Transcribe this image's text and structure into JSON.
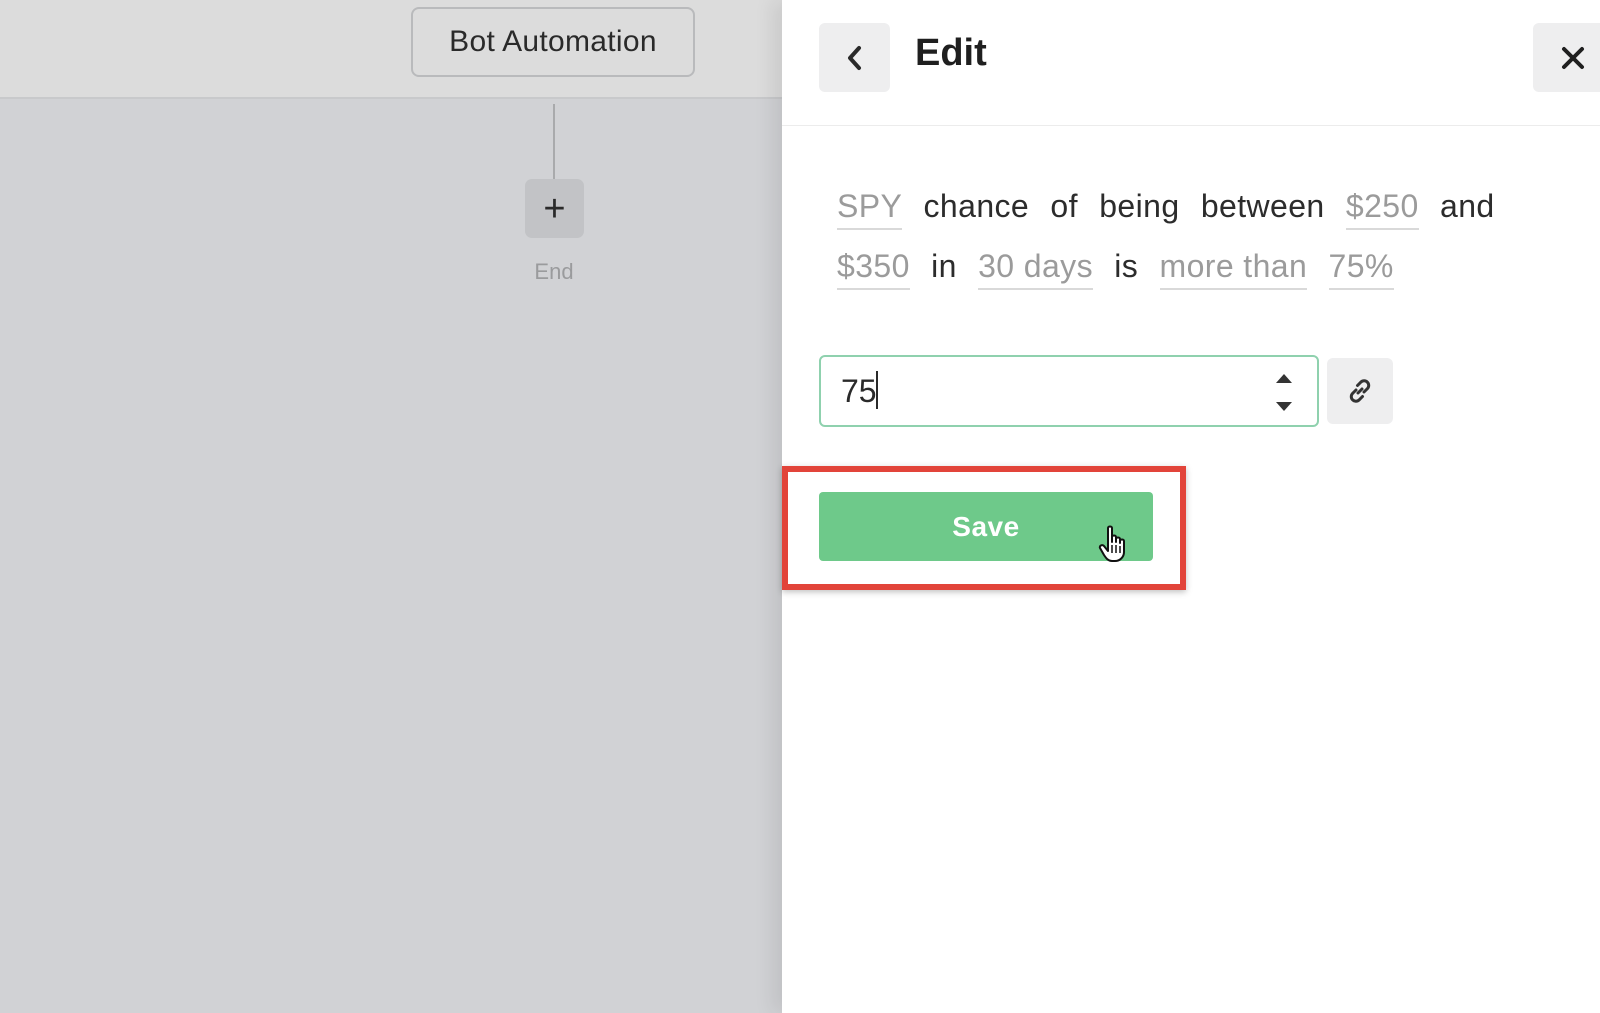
{
  "canvas": {
    "bot_node_label": "Bot Automation",
    "add_node_symbol": "+",
    "end_label": "End"
  },
  "panel": {
    "title": "Edit",
    "back_icon": "chevron-left-icon",
    "close_icon": "close-icon",
    "sentence": {
      "ticker": "SPY",
      "text1": "chance",
      "text2": "of",
      "text3": "being",
      "text4": "between",
      "lower_price": "$250",
      "text5": "and",
      "upper_price": "$350",
      "text6": "in",
      "period": "30 days",
      "text7": "is",
      "comparison": "more than",
      "threshold": "75%"
    },
    "number_input": {
      "value": "75"
    },
    "link_icon": "link-icon",
    "save_label": "Save"
  },
  "colors": {
    "accent_green": "#6ec98a",
    "input_border": "#8fd1ae",
    "highlight_red": "#e2443a"
  }
}
